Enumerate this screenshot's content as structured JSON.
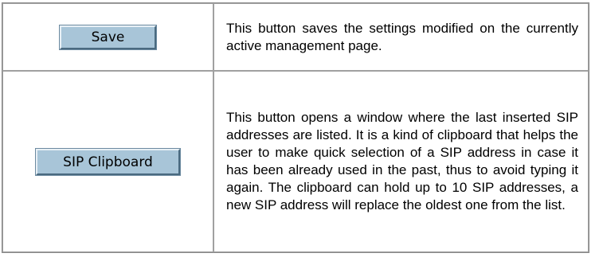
{
  "rows": [
    {
      "button_label": "Save",
      "description": "This button saves the settings modified on the currently active management page."
    },
    {
      "button_label": "SIP Clipboard",
      "description": "This button opens a window where the last inserted SIP addresses are listed. It is a kind of clipboard that helps the user to make quick selection of a SIP address in case it has been already used in the past, thus to avoid typing it again. The clipboard can hold up to 10 SIP addresses, a new SIP address will replace the oldest one from the list."
    }
  ],
  "colors": {
    "button_face": "#a8c5d8",
    "table_border": "#a0a0a0"
  }
}
